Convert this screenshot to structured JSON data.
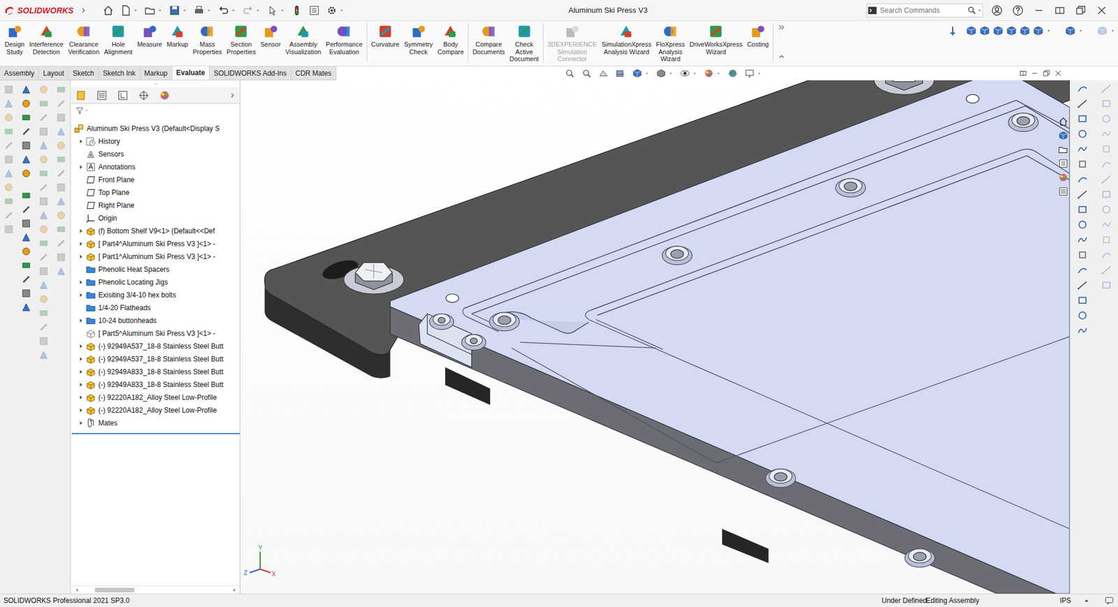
{
  "app": {
    "logo": "SOLIDWORKS"
  },
  "window": {
    "title": "Aluminum Ski Press V3"
  },
  "search": {
    "placeholder": "Search Commands"
  },
  "command_groups": [
    [
      {
        "label": "Design Study",
        "disabled": false
      },
      {
        "label": "Interference Detection",
        "disabled": false
      },
      {
        "label": "Clearance Verification",
        "disabled": false
      },
      {
        "label": "Hole Alignment",
        "disabled": false
      },
      {
        "label": "Measure",
        "disabled": false
      },
      {
        "label": "Markup",
        "disabled": false
      },
      {
        "label": "Mass Properties",
        "disabled": false
      },
      {
        "label": "Section Properties",
        "disabled": false
      },
      {
        "label": "Sensor",
        "disabled": false
      },
      {
        "label": "Assembly Visualization",
        "disabled": false
      },
      {
        "label": "Performance Evaluation",
        "disabled": false
      }
    ],
    [
      {
        "label": "Curvature",
        "disabled": false
      },
      {
        "label": "Symmetry Check",
        "disabled": false
      },
      {
        "label": "Body Compare",
        "disabled": false
      }
    ],
    [
      {
        "label": "Compare Documents",
        "disabled": false
      },
      {
        "label": "Check Active Document",
        "disabled": false
      }
    ],
    [
      {
        "label": "3DEXPERIENCE Simulation Connector",
        "disabled": true
      },
      {
        "label": "SimulationXpress Analysis Wizard",
        "disabled": false
      },
      {
        "label": "FloXpress Analysis Wizard",
        "disabled": false
      },
      {
        "label": "DriveWorksXpress Wizard",
        "disabled": false
      },
      {
        "label": "Costing",
        "disabled": false
      }
    ]
  ],
  "tabs": [
    {
      "label": "Assembly",
      "selected": false
    },
    {
      "label": "Layout",
      "selected": false
    },
    {
      "label": "Sketch",
      "selected": false
    },
    {
      "label": "Sketch Ink",
      "selected": false
    },
    {
      "label": "Markup",
      "selected": false
    },
    {
      "label": "Evaluate",
      "selected": true
    },
    {
      "label": "SOLIDWORKS Add-Ins",
      "selected": false
    },
    {
      "label": "CDR Mates",
      "selected": false
    }
  ],
  "left_toolbars": [
    {
      "disabled": true
    },
    {
      "disabled": false
    },
    {
      "disabled": true
    },
    {
      "disabled": true
    }
  ],
  "right_toolbars": [
    {
      "disabled": false
    },
    {
      "disabled": true
    }
  ],
  "tree": {
    "root": "Aluminum Ski Press V3  (Default<Display S",
    "items": [
      {
        "label": "History",
        "kind": "history",
        "expander": true
      },
      {
        "label": "Sensors",
        "kind": "sensors",
        "expander": false
      },
      {
        "label": "Annotations",
        "kind": "annotations",
        "expander": true
      },
      {
        "label": "Front Plane",
        "kind": "plane",
        "expander": false
      },
      {
        "label": "Top Plane",
        "kind": "plane",
        "expander": false
      },
      {
        "label": "Right Plane",
        "kind": "plane",
        "expander": false
      },
      {
        "label": "Origin",
        "kind": "origin",
        "expander": false
      },
      {
        "label": "(f) Bottom Shelf V9<1> (Default<<Def",
        "kind": "part",
        "expander": true
      },
      {
        "label": "[ Part4^Aluminum Ski Press V3 ]<1> -",
        "kind": "part",
        "expander": true
      },
      {
        "label": "[ Part1^Aluminum Ski Press V3 ]<1> -",
        "kind": "part",
        "expander": true
      },
      {
        "label": "Phenolic Heat Spacers",
        "kind": "folder",
        "expander": false
      },
      {
        "label": "Phenolic Locating Jigs",
        "kind": "folder",
        "expander": true
      },
      {
        "label": "Exisiting 3/4-10 hex bolts",
        "kind": "folder",
        "expander": true
      },
      {
        "label": "1/4-20 Flatheads",
        "kind": "folder",
        "expander": false
      },
      {
        "label": "10-24 buttonheads",
        "kind": "folder",
        "expander": true
      },
      {
        "label": "[ Part5^Aluminum Ski Press V3 ]<1> -",
        "kind": "part-hidden",
        "expander": false
      },
      {
        "label": "(-) 92949A537_18-8 Stainless Steel Butt",
        "kind": "part",
        "expander": true
      },
      {
        "label": "(-) 92949A537_18-8 Stainless Steel Butt",
        "kind": "part",
        "expander": true
      },
      {
        "label": "(-) 92949A833_18-8 Stainless Steel Butt",
        "kind": "part",
        "expander": true
      },
      {
        "label": "(-) 92949A833_18-8 Stainless Steel Butt",
        "kind": "part",
        "expander": true
      },
      {
        "label": "(-) 92220A182_Alloy Steel Low-Profile",
        "kind": "part",
        "expander": true
      },
      {
        "label": "(-) 92220A182_Alloy Steel Low-Profile",
        "kind": "part",
        "expander": true
      },
      {
        "label": "Mates",
        "kind": "mates",
        "expander": true
      }
    ]
  },
  "triad": {
    "y": "Y",
    "z": "Z",
    "x": "X"
  },
  "status_bar": {
    "product": "SOLIDWORKS Professional 2021 SP3.0",
    "state": "Under Defined",
    "mode": "Editing Assembly",
    "units": "IPS"
  }
}
